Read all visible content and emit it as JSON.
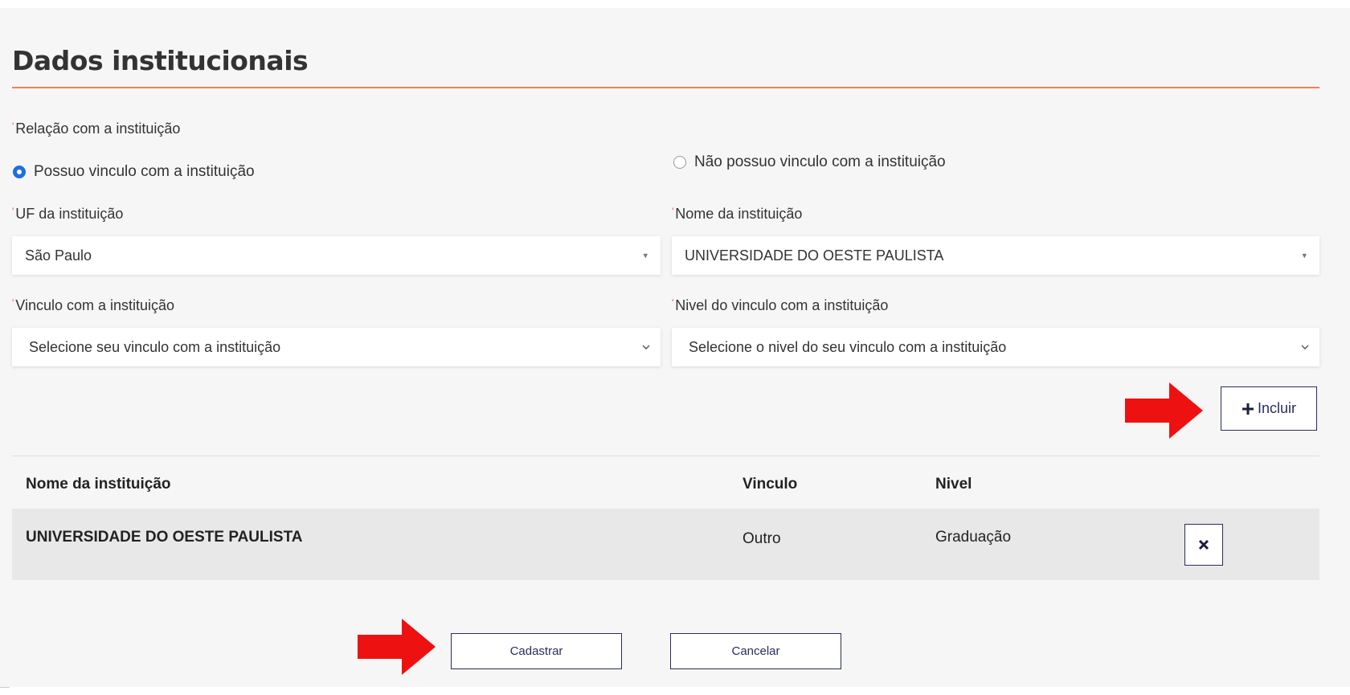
{
  "section": {
    "title": "Dados institucionais"
  },
  "relation": {
    "label": "Relação com a instituição",
    "option_yes": "Possuo vinculo com a instituição",
    "option_no": "Não possuo vinculo com a instituição",
    "selected": "option_yes"
  },
  "uf": {
    "label": "UF da instituição",
    "value": "São Paulo"
  },
  "institution_name": {
    "label": "Nome da instituição",
    "value": "UNIVERSIDADE DO OESTE PAULISTA"
  },
  "link": {
    "label": "Vinculo com a instituição",
    "placeholder": "Selecione seu vinculo com a instituição"
  },
  "level": {
    "label": "Nivel do vinculo com a instituição",
    "placeholder": "Selecione o nivel do seu vinculo com a instituição"
  },
  "include_button": {
    "icon": "plus-icon",
    "label": "Incluir"
  },
  "table": {
    "headers": [
      "Nome da instituição",
      "Vinculo",
      "Nivel"
    ],
    "rows": [
      {
        "name": "UNIVERSIDADE DO OESTE PAULISTA",
        "link": "Outro",
        "level": "Graduação",
        "remove_icon": "close-icon"
      }
    ]
  },
  "actions": {
    "submit_label": "Cadastrar",
    "cancel_label": "Cancelar"
  },
  "colors": {
    "accent_rule": "#f0814a",
    "button_border": "#2a2e5c",
    "radio_checked": "#1c6fe0",
    "annotation_arrow": "#ee1111",
    "required_mark": "#e8503a"
  }
}
